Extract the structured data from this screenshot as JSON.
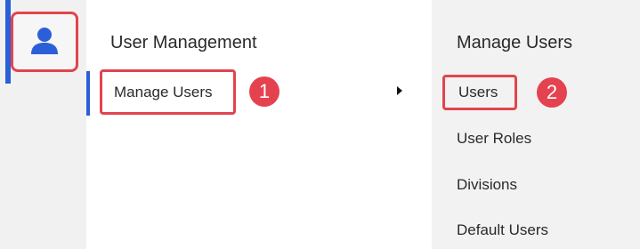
{
  "rail": {
    "icon": "user-icon",
    "accent_color": "#2a5fd8",
    "highlight_color": "#e0454f"
  },
  "menu": {
    "title": "User Management",
    "items": [
      {
        "label": "Manage Users",
        "step": "1",
        "has_submenu": true
      }
    ]
  },
  "submenu": {
    "title": "Manage Users",
    "items": [
      {
        "label": "Users",
        "step": "2"
      },
      {
        "label": "User Roles"
      },
      {
        "label": "Divisions"
      },
      {
        "label": "Default Users"
      }
    ]
  }
}
